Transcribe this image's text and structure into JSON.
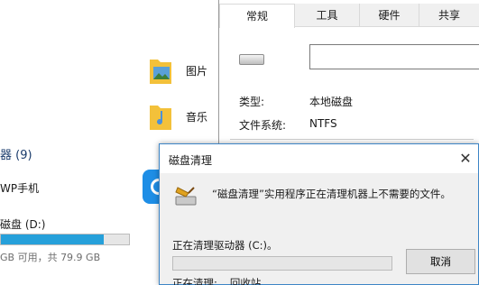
{
  "explorer": {
    "folders": [
      {
        "label": "图片",
        "icon": "pictures-folder-icon"
      },
      {
        "label": "音乐",
        "icon": "music-folder-icon"
      }
    ],
    "section_title": "器 (9)",
    "devices": [
      {
        "label": "WP手机",
        "icon": "phone-sync-icon"
      }
    ],
    "drive_d": {
      "label": "磁盘 (D:)",
      "stats": "GB 可用，共 79.9 GB",
      "used_fraction": 0.8
    }
  },
  "properties": {
    "tabs": [
      "常规",
      "工具",
      "硬件",
      "共享"
    ],
    "active_tab": "常规",
    "name_value": "",
    "type_label": "类型:",
    "type_value": "本地磁盘",
    "fs_label": "文件系统:",
    "fs_value": "NTFS"
  },
  "cleanup": {
    "title": "磁盘清理",
    "message": "“磁盘清理”实用程序正在清理机器上不需要的文件。",
    "cleaning_drive": "正在清理驱动器 (C:)。",
    "progress_fraction": 0.0,
    "cancel_label": "取消",
    "cleaning_label": "正在清理:",
    "cleaning_item": "回收站",
    "close_glyph": "✕"
  },
  "colors": {
    "accent": "#3d85c6",
    "drive_bar": "#26a0da",
    "progress": "#06b025"
  }
}
